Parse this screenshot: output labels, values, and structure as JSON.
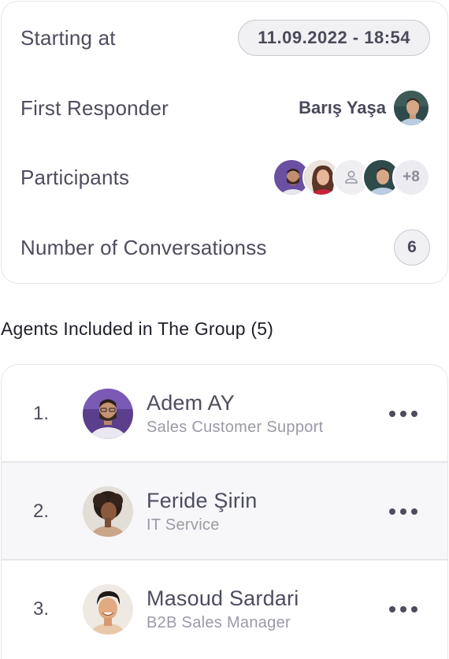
{
  "summary": {
    "starting_label": "Starting at",
    "starting_value": "11.09.2022 - 18:54",
    "responder_label": "First Responder",
    "responder_name": "Barış Yaşa",
    "participants_label": "Participants",
    "participants_more": "+8",
    "conversations_label": "Number of Conversationss",
    "conversations_count": "6"
  },
  "agents": {
    "title": "Agents Included in The Group (5)",
    "items": [
      {
        "index": "1.",
        "name": "Adem AY",
        "role": "Sales Customer Support"
      },
      {
        "index": "2.",
        "name": "Feride Şirin",
        "role": "IT Service"
      },
      {
        "index": "3.",
        "name": "Masoud Sardari",
        "role": "B2B Sales Manager"
      }
    ]
  },
  "icons": {
    "more": "more-horizontal-icon",
    "user_placeholder": "user-icon"
  },
  "colors": {
    "text": "#4d4d5f",
    "muted": "#9a9aa8",
    "border": "#e6e6ea",
    "pill_bg": "#f1f1f4"
  }
}
